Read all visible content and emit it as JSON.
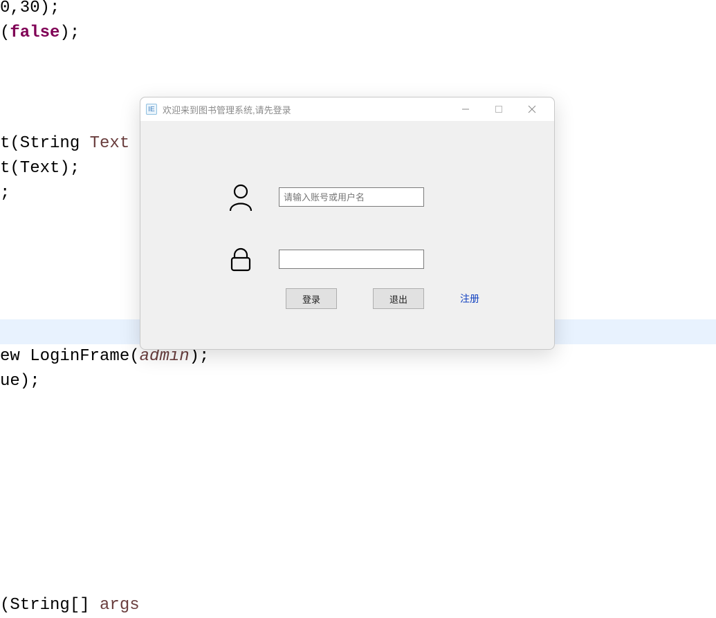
{
  "code": {
    "line1": "0,30);",
    "line2_prefix": "(",
    "line2_kw": "false",
    "line2_suffix": ");",
    "line3_prefix": "t(String ",
    "line3_var": "Text",
    "line4": "t(Text);",
    "line5": ";",
    "line6_prefix": "(String[] ",
    "line6_var": "args",
    "line7_prefix": "ew LoginFrame(",
    "line7_param": "admin",
    "line7_suffix": ");",
    "line8": "ue);"
  },
  "dialog": {
    "title": "欢迎来到图书管理系统,请先登录",
    "username": {
      "placeholder": "请输入账号或用户名",
      "value": ""
    },
    "password": {
      "value": ""
    },
    "buttons": {
      "login": "登录",
      "exit": "退出"
    },
    "register_link": "注册"
  }
}
